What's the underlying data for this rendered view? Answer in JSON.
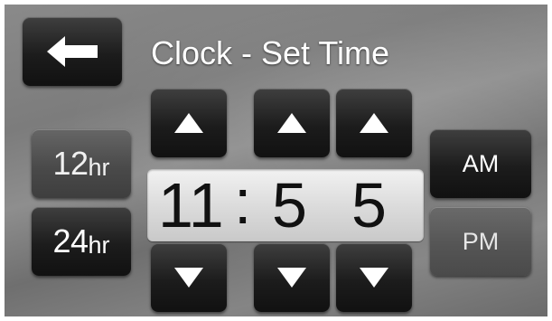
{
  "header": {
    "title": "Clock - Set Time",
    "back_icon": "left-arrow-icon"
  },
  "format": {
    "hr12_num": "12",
    "hr12_unit": "hr",
    "hr24_num": "24",
    "hr24_unit": "hr"
  },
  "meridiem": {
    "am": "AM",
    "pm": "PM"
  },
  "time": {
    "hours": "11",
    "separator": ":",
    "minute_tens": "5",
    "minute_ones": "5"
  },
  "controls": {
    "up_icon": "up-arrow-icon",
    "down_icon": "down-arrow-icon"
  }
}
